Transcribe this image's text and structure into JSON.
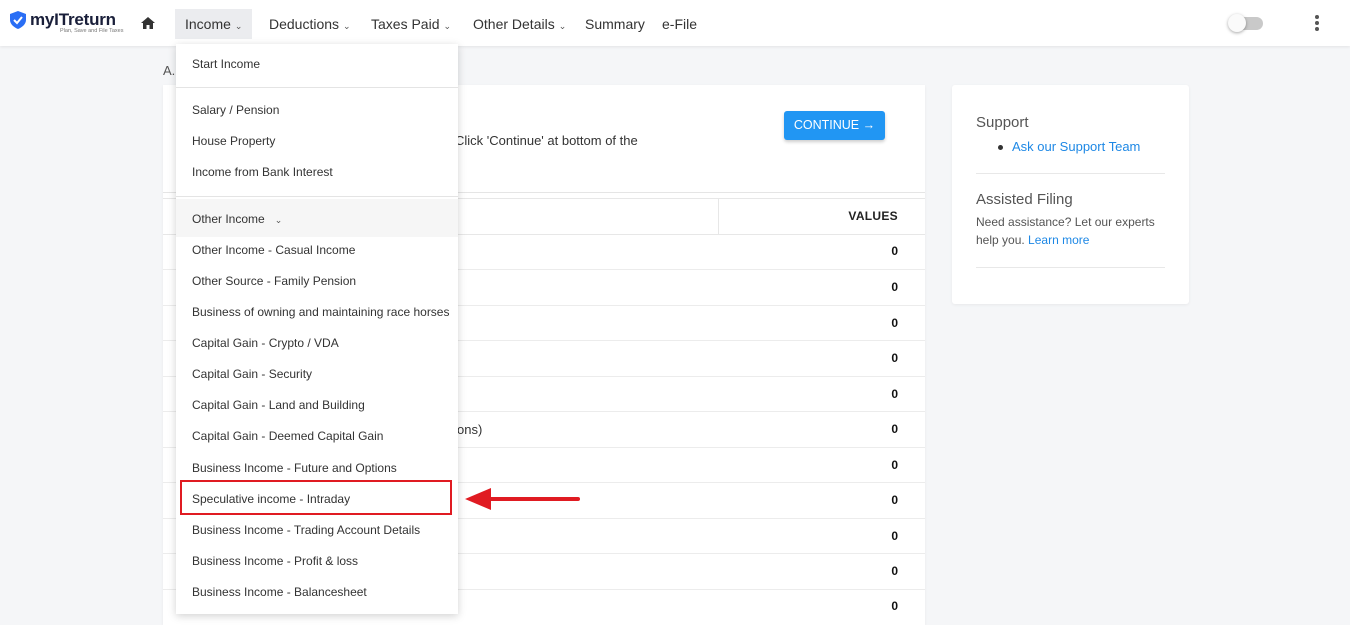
{
  "brand": {
    "name": "myITreturn",
    "tagline": "Plan, Save and File Taxes"
  },
  "nav": {
    "home_icon": "home-icon",
    "items": [
      {
        "label": "Income",
        "has_dropdown": true,
        "active": true
      },
      {
        "label": "Deductions",
        "has_dropdown": true
      },
      {
        "label": "Taxes Paid",
        "has_dropdown": true
      },
      {
        "label": "Other Details",
        "has_dropdown": true
      },
      {
        "label": "Summary",
        "has_dropdown": false
      },
      {
        "label": "e-File",
        "has_dropdown": false
      }
    ]
  },
  "main": {
    "breadcrumb_fragment": "A.",
    "note_fragment": "Click 'Continue' at bottom of the",
    "continue_label": "CONTINUE",
    "table": {
      "values_header": "VALUES",
      "label_fragment": "ons)",
      "values": [
        "0",
        "0",
        "0",
        "0",
        "0",
        "0",
        "0",
        "0",
        "0",
        "0",
        "0"
      ]
    }
  },
  "dropdown": {
    "items": [
      "Start Income",
      "Salary / Pension",
      "House Property",
      "Income from Bank Interest",
      "Other Income",
      "Other Income - Casual Income",
      "Other Source - Family Pension",
      "Business of owning and maintaining race horses",
      "Capital Gain - Crypto / VDA",
      "Capital Gain - Security",
      "Capital Gain - Land and Building",
      "Capital Gain - Deemed Capital Gain",
      "Business Income - Future and Options",
      "Speculative income - Intraday",
      "Business Income - Trading Account Details",
      "Business Income - Profit & loss",
      "Business Income - Balancesheet"
    ],
    "highlighted": "Speculative income - Intraday"
  },
  "sidebar": {
    "support_title": "Support",
    "support_link": "Ask our Support Team",
    "assisted_title": "Assisted Filing",
    "assisted_text": "Need assistance? Let our experts help you.",
    "learn_more": "Learn more"
  },
  "colors": {
    "accent": "#2196f3",
    "highlight": "#e01b22",
    "link": "#1e88e5"
  }
}
